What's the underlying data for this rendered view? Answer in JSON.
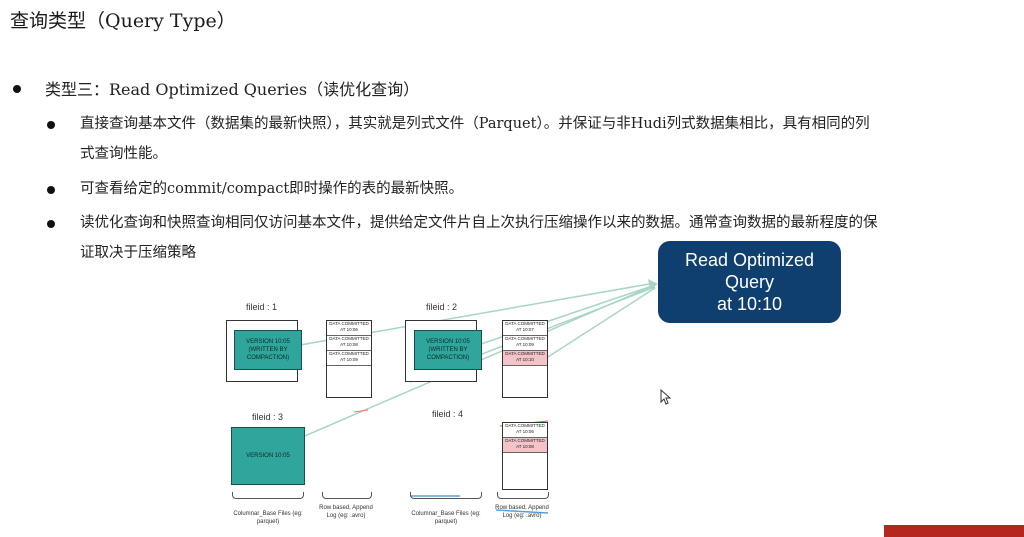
{
  "title": "查询类型（Query Type）",
  "section": {
    "heading": "类型三：Read Optimized Queries（读优化查询）",
    "bullets": [
      {
        "line1": "直接查询基本文件（数据集的最新快照），其实就是列式文件（Parquet）。并保证与非Hudi列式数据集相比，具有相同的列",
        "line2": "式查询性能。"
      },
      {
        "line1": "可查看给定的commit/compact即时操作的表的最新快照。"
      },
      {
        "line1": "读优化查询和快照查询相同仅访问基本文件，提供给定文件片自上次执行压缩操作以来的数据。通常查询数据的最新程度的保",
        "line2": "证取决于压缩策略"
      }
    ]
  },
  "diagram": {
    "query_box": {
      "line1": "Read Optimized",
      "line2": "Query",
      "line3": "at 10:10",
      "color": "#0e3f6e"
    },
    "file_ids": [
      "fileid : 1",
      "fileid : 2",
      "fileid : 3",
      "fileid : 4"
    ],
    "base_files": [
      {
        "text": "VERSION 10:05 (WRITTEN BY COMPACTION)"
      },
      {
        "text": "VERSION 10:05 (WRITTEN BY COMPACTION)"
      },
      {
        "text": "VERSION 10:05"
      }
    ],
    "logs": {
      "fileid1": [
        "DATA COMMITTED AT 10:06",
        "DATA COMMITTED AT 10:08",
        "DATA COMMITTED AT 10:09"
      ],
      "fileid2": [
        "DATA COMMITTED AT 10:07",
        "DATA COMMITTED AT 10:09",
        "DATA COMMITTED AT 10:10"
      ],
      "fileid4": [
        "DATA COMMITTED AT 10:06",
        "DATA COMMITTED AT 10:08"
      ]
    },
    "captions": {
      "columnar1": "Columnar_Base Files (eg: parquet)",
      "rowbased1": "Row based, Append Log (eg: .avro)",
      "columnar2": "Columnar_Base Files (eg: parquet)",
      "rowbased2": "Row based, Append Log (eg: .avro)"
    },
    "highlight_color": "#f3c3c8",
    "base_color": "#2fa59b"
  }
}
